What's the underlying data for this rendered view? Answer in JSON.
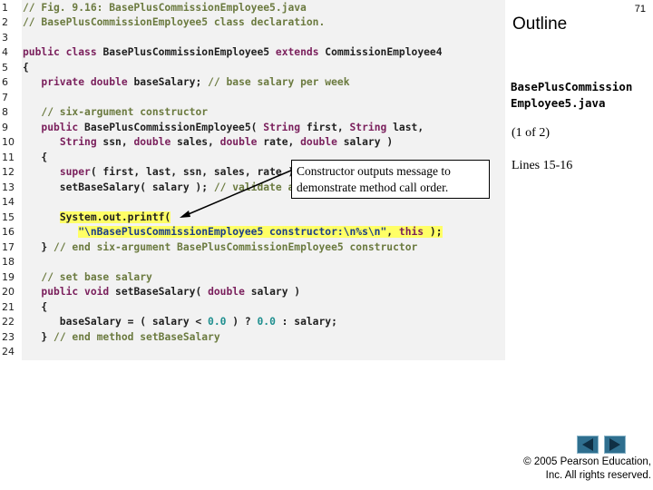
{
  "slide": {
    "outline_title": "Outline",
    "slide_number": "71",
    "filename": "BasePlusCommission Employee5.java",
    "page_indicator": "(1 of 2)",
    "lines_note": "Lines 15-16",
    "callout": "Constructor outputs message to demonstrate method call order.",
    "copyright_line1": "© 2005 Pearson Education,",
    "copyright_line2": "Inc.  All rights reserved."
  },
  "code_lines": [
    {
      "n": "1",
      "t": "// Fig. 9.16: BasePlusCommissionEmployee5.java"
    },
    {
      "n": "2",
      "t": "// BasePlusCommissionEmployee5 class declaration."
    },
    {
      "n": "3",
      "t": ""
    },
    {
      "n": "4",
      "t": "public class BasePlusCommissionEmployee5 extends CommissionEmployee4"
    },
    {
      "n": "5",
      "t": "{"
    },
    {
      "n": "6",
      "t": "   private double baseSalary; // base salary per week"
    },
    {
      "n": "7",
      "t": ""
    },
    {
      "n": "8",
      "t": "   // six-argument constructor"
    },
    {
      "n": "9",
      "t": "   public BasePlusCommissionEmployee5( String first, String last,"
    },
    {
      "n": "10",
      "t": "      String ssn, double sales, double rate, double salary )"
    },
    {
      "n": "11",
      "t": "   {"
    },
    {
      "n": "12",
      "t": "      super( first, last, ssn, sales, rate );"
    },
    {
      "n": "13",
      "t": "      setBaseSalary( salary ); // validate and store base salary"
    },
    {
      "n": "14",
      "t": ""
    },
    {
      "n": "15",
      "t": "      System.out.printf("
    },
    {
      "n": "16",
      "t": "         \"\\nBasePlusCommissionEmployee5 constructor:\\n%s\\n\", this );"
    },
    {
      "n": "17",
      "t": "   } // end six-argument BasePlusCommissionEmployee5 constructor"
    },
    {
      "n": "18",
      "t": ""
    },
    {
      "n": "19",
      "t": "   // set base salary"
    },
    {
      "n": "20",
      "t": "   public void setBaseSalary( double salary )"
    },
    {
      "n": "21",
      "t": "   {"
    },
    {
      "n": "22",
      "t": "      baseSalary = ( salary < 0.0 ) ? 0.0 : salary;"
    },
    {
      "n": "23",
      "t": "   } // end method setBaseSalary"
    },
    {
      "n": "24",
      "t": ""
    }
  ],
  "colors": {
    "keyword": "#7a1f5c",
    "comment": "#6b7a3f",
    "string": "#1b3d8a",
    "highlight": "#ffff66",
    "nav_button": "#2f6f8f"
  },
  "nav": {
    "prev_icon": "triangle-left-icon",
    "next_icon": "triangle-right-icon"
  }
}
